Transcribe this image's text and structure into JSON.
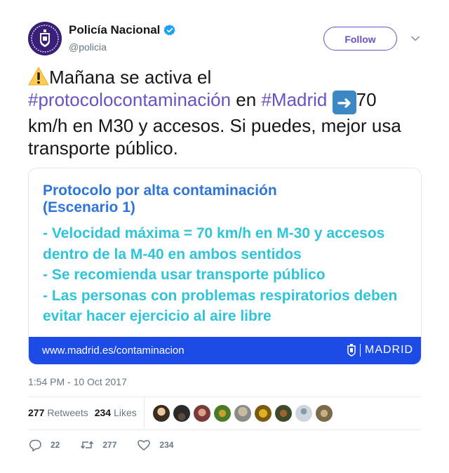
{
  "user": {
    "display_name": "Policía Nacional",
    "handle": "@policia",
    "verified": true,
    "follow_label": "Follow"
  },
  "tweet": {
    "text_1": "Mañana se activa el",
    "hashtag_1": "#protocolocontaminación",
    "text_2": " en ",
    "hashtag_2": "#Madrid",
    "text_3": "70 km/h en M30 y accesos. Si puedes, mejor usa transporte público.",
    "emoji_1": "warning-emoji",
    "emoji_2": "right-arrow-emoji"
  },
  "card": {
    "title_line_1": "Protocolo por alta contaminación",
    "title_line_2": "(Escenario 1)",
    "bullet_1_line_1": "- Velocidad máxima = 70 km/h en M-30 y accesos",
    "bullet_1_line_2": "dentro de la M-40 en ambos sentidos",
    "bullet_2": "- Se recomienda usar transporte público",
    "bullet_3_line_1": "- Las personas con problemas respiratorios deben",
    "bullet_3_line_2": "evitar hacer ejercicio al aire libre",
    "url": "www.madrid.es/contaminacion",
    "logo_text": "MADRID"
  },
  "timestamp": "1:54 PM - 10 Oct 2017",
  "stats": {
    "retweets_count": "277",
    "retweets_label": "Retweets",
    "likes_count": "234",
    "likes_label": "Likes"
  },
  "actions": {
    "reply_count": "22",
    "retweet_count": "277",
    "like_count": "234"
  },
  "colors": {
    "accent": "#6c51c4",
    "card_blue": "#1d4be8",
    "card_title": "#2e75d9",
    "card_body": "#2ec4d9"
  }
}
